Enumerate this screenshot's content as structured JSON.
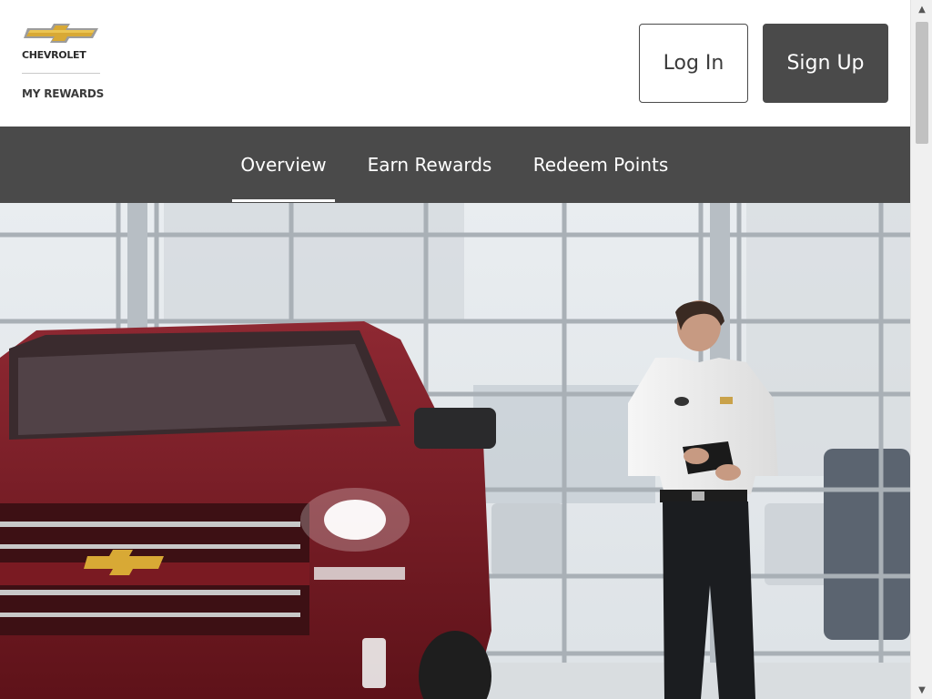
{
  "header": {
    "brand_name": "CHEVROLET",
    "brand_sub": "MY REWARDS",
    "login_label": "Log In",
    "signup_label": "Sign Up"
  },
  "nav": {
    "items": [
      {
        "label": "Overview",
        "active": true
      },
      {
        "label": "Earn Rewards",
        "active": false
      },
      {
        "label": "Redeem Points",
        "active": false
      }
    ]
  },
  "colors": {
    "nav_bg": "#4a4a4a",
    "bowtie_gold": "#d8a935",
    "truck_red": "#7a1a22"
  },
  "icons": {
    "logo": "chevrolet-bowtie-icon",
    "scroll_up": "triangle-up-icon",
    "scroll_down": "triangle-down-icon"
  }
}
